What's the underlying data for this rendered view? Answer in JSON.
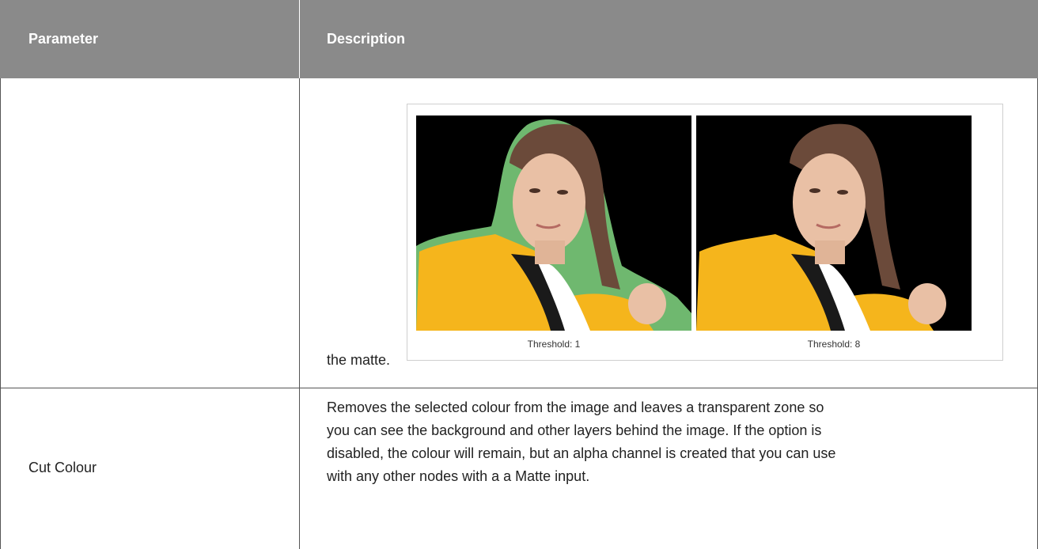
{
  "table": {
    "headers": {
      "parameter": "Parameter",
      "description": "Description"
    },
    "rows": [
      {
        "parameter": "",
        "description_text": "the matte.",
        "figure": {
          "captions": [
            "Threshold: 1",
            "Threshold: 8"
          ]
        }
      },
      {
        "parameter": "Cut Colour",
        "description_lines": [
          "Removes the selected colour from the image and leaves a transparent zone so",
          "you can see the background and other layers behind the image. If the option is",
          "disabled, the colour will remain, but an alpha channel is created that you can use",
          "with any other nodes with a a Matte input."
        ]
      }
    ]
  },
  "colors": {
    "header_bg": "#8a8a8a",
    "header_text": "#ffffff",
    "border": "#555555",
    "matte_outline": "#6fb86f",
    "jacket_yellow": "#f5b51c"
  }
}
